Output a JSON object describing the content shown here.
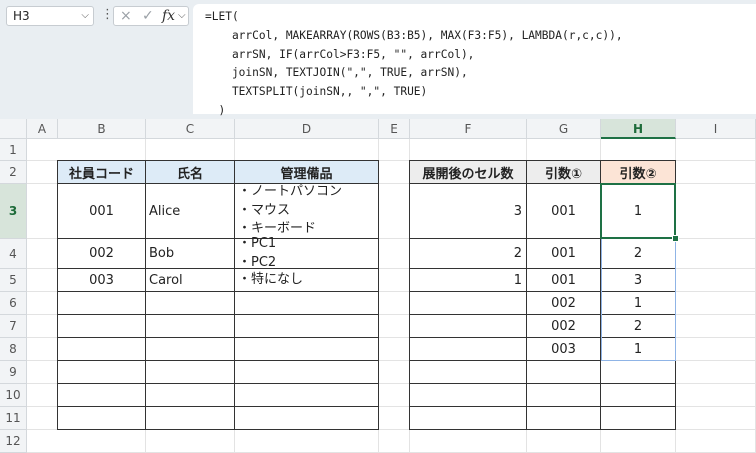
{
  "namebox": {
    "value": "H3"
  },
  "formula_bar": {
    "lines": [
      "=LET(",
      "    arrCol, MAKEARRAY(ROWS(B3:B5), MAX(F3:F5), LAMBDA(r,c,c)),",
      "    arrSN, IF(arrCol>F3:F5, \"\", arrCol),",
      "    joinSN, TEXTJOIN(\",\", TRUE, arrSN),",
      "    TEXTSPLIT(joinSN,, \",\", TRUE)",
      "  )"
    ]
  },
  "icons": {
    "cancel": "×",
    "confirm": "✓",
    "fx": "fx",
    "more": "⋮",
    "chevron": "⌵"
  },
  "columns": [
    "A",
    "B",
    "C",
    "D",
    "E",
    "F",
    "G",
    "H",
    "I"
  ],
  "rows": [
    "1",
    "2",
    "3",
    "4",
    "5",
    "6",
    "7",
    "8",
    "9",
    "10",
    "11",
    "12"
  ],
  "colors": {
    "header_blue": "#ddebf7",
    "header_gray": "#ededed",
    "header_orange": "#fce4d6",
    "active_green": "#1e7145",
    "spill_blue": "#8fb4e6"
  },
  "table1": {
    "headers": [
      "社員コード",
      "氏名",
      "管理備品"
    ],
    "rows": [
      {
        "code": "001",
        "name": "Alice",
        "items": [
          "・ノートパソコン",
          "・マウス",
          "・キーボード"
        ]
      },
      {
        "code": "002",
        "name": "Bob",
        "items": [
          "・PC1",
          "・PC2"
        ]
      },
      {
        "code": "003",
        "name": "Carol",
        "items": [
          "・特になし"
        ]
      }
    ]
  },
  "table2": {
    "headers": [
      "展開後のセル数",
      "引数①",
      "引数②"
    ],
    "counts": [
      "3",
      "2",
      "1"
    ],
    "arg1": [
      "001",
      "001",
      "001",
      "002",
      "002",
      "003"
    ],
    "arg2": [
      "1",
      "2",
      "3",
      "1",
      "2",
      "1"
    ]
  }
}
